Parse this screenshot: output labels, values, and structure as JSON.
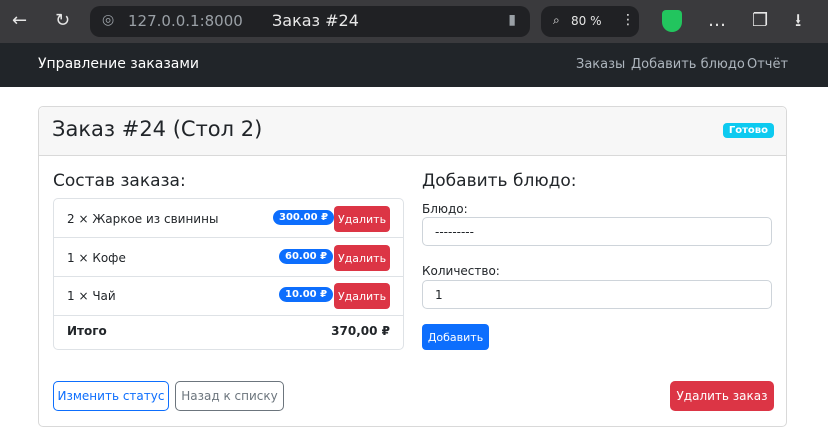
{
  "browser": {
    "url": "127.0.0.1:8000",
    "tab_title": "Заказ #24",
    "zoom": "80 %"
  },
  "navbar": {
    "brand": "Управление заказами",
    "links": [
      "Заказы",
      "Добавить блюдо",
      "Отчёт"
    ]
  },
  "order": {
    "title": "Заказ #24 (Стол 2)",
    "status": "Готово",
    "items_heading": "Состав заказа:",
    "items": [
      {
        "text": "2 × Жаркое из свинины",
        "price": "300.00 ₽",
        "delete_label": "Удалить"
      },
      {
        "text": "1 × Кофе",
        "price": "60.00 ₽",
        "delete_label": "Удалить"
      },
      {
        "text": "1 × Чай",
        "price": "10.00 ₽",
        "delete_label": "Удалить"
      }
    ],
    "total_label": "Итого",
    "total_value": "370,00 ₽"
  },
  "add_form": {
    "heading": "Добавить блюдо:",
    "dish_label": "Блюдо:",
    "dish_value": "---------",
    "qty_label": "Количество:",
    "qty_value": "1",
    "submit_label": "Добавить"
  },
  "actions": {
    "change_status": "Изменить статус",
    "back": "Назад к списку",
    "delete_order": "Удалить заказ"
  },
  "colors": {
    "primary": "#0d6efd",
    "danger": "#dc3545",
    "info": "#0dcaf0",
    "navbar": "#212529"
  }
}
